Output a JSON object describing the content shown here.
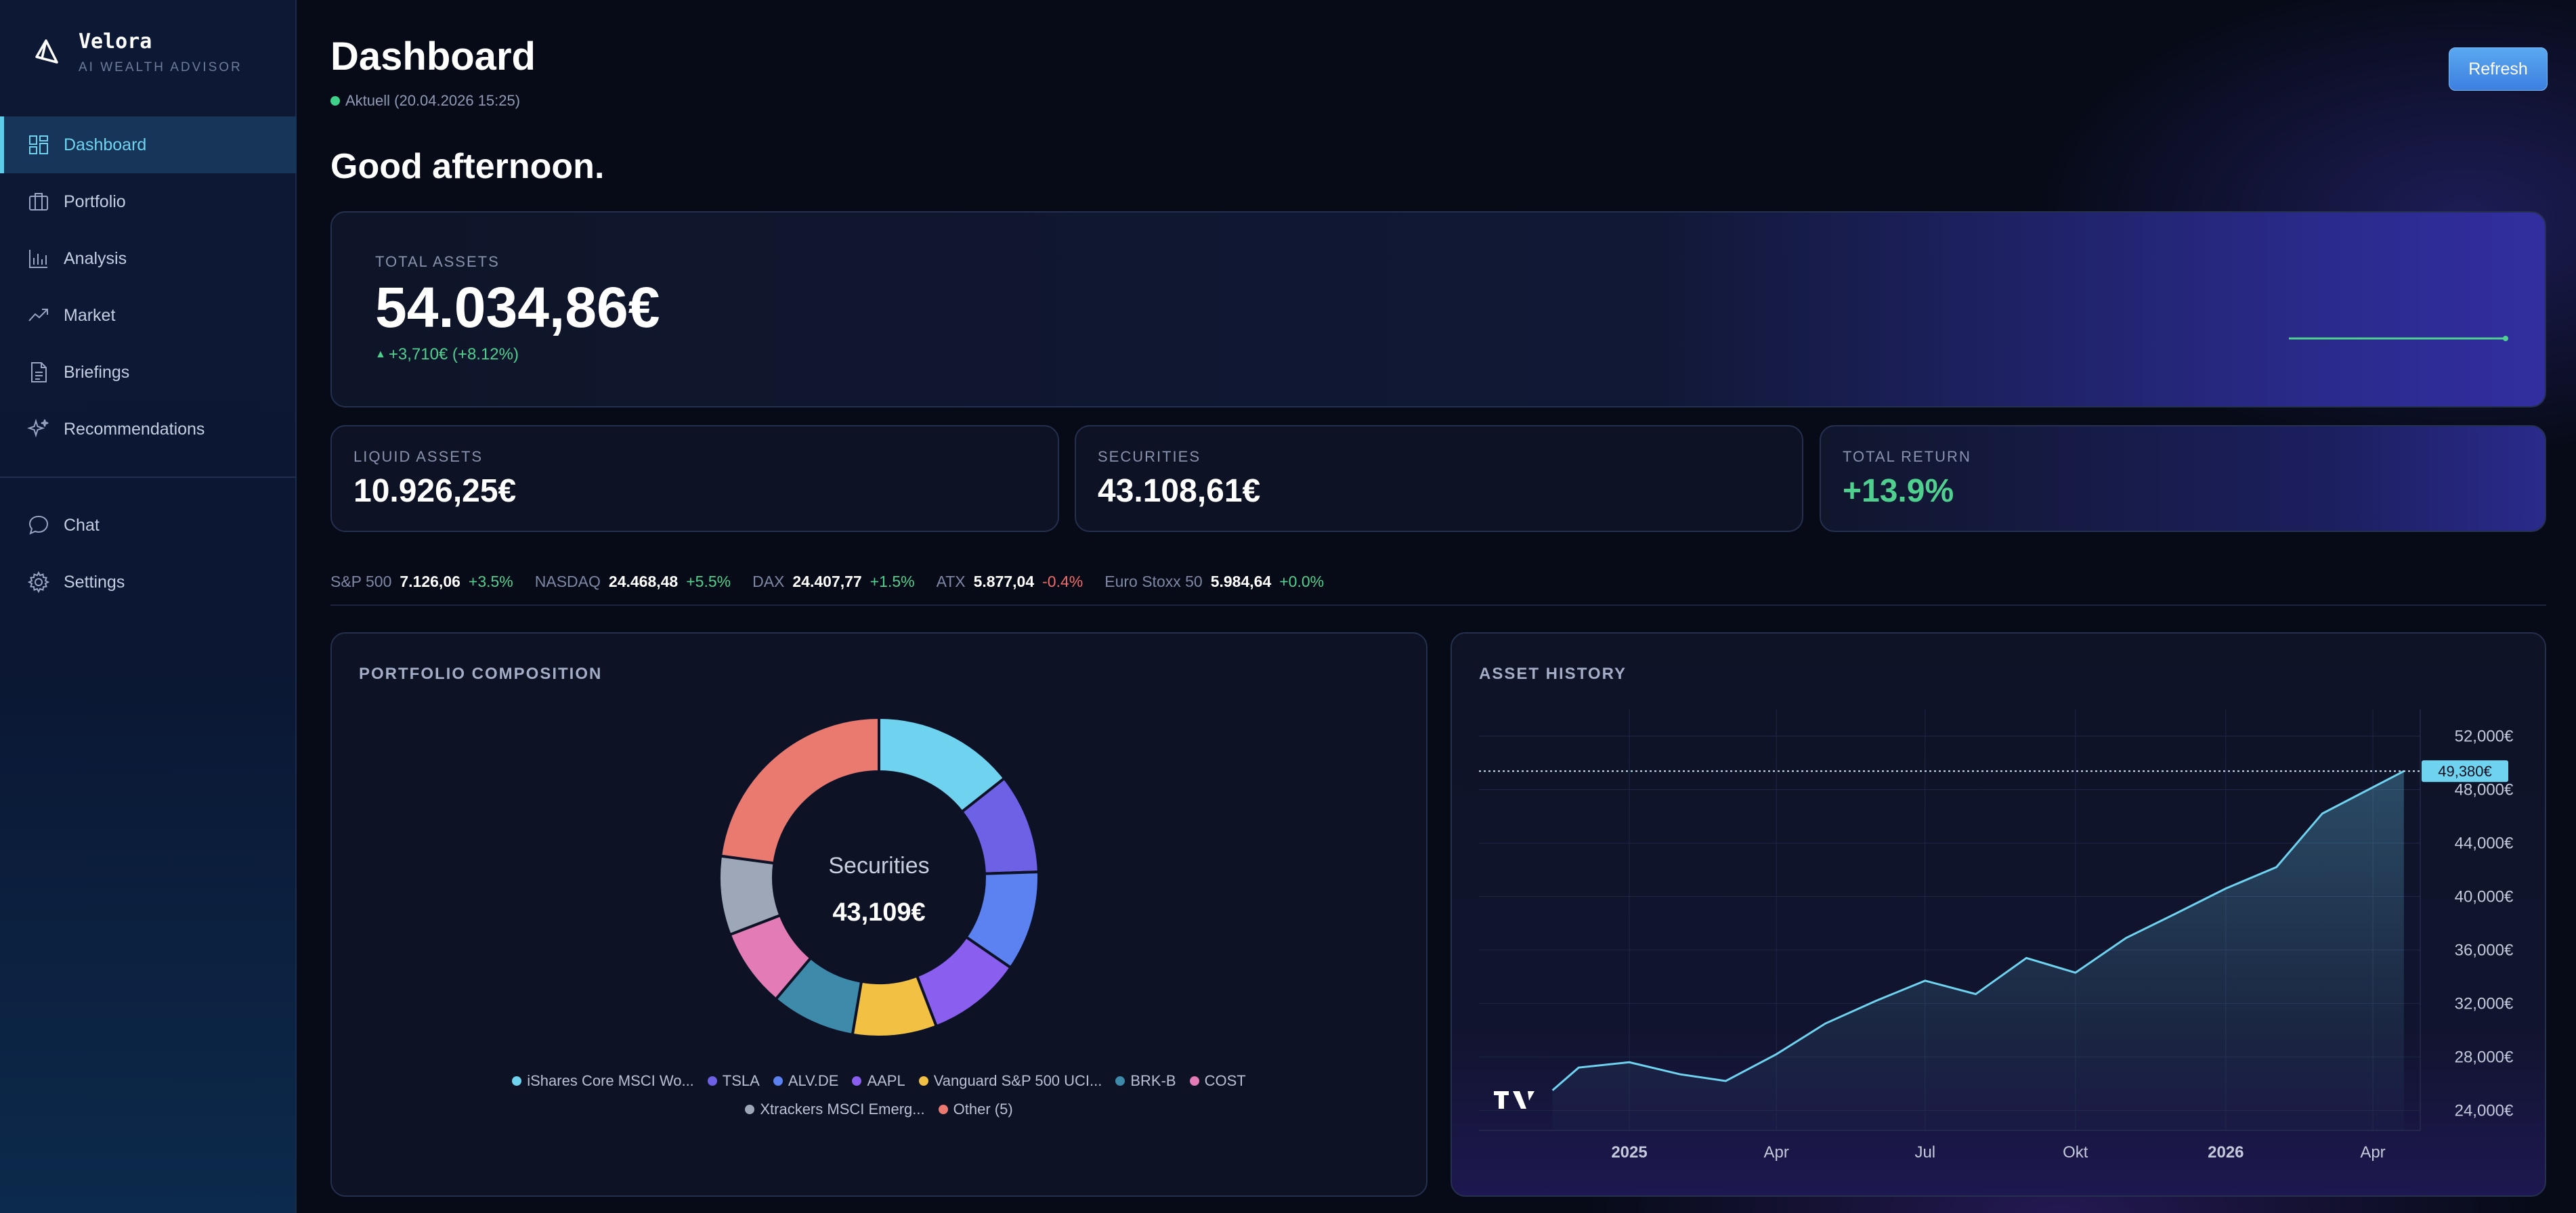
{
  "app": {
    "brand_name": "Velora",
    "brand_sub": "AI WEALTH ADVISOR"
  },
  "sidebar": {
    "items": [
      {
        "label": "Dashboard",
        "icon": "grid-icon",
        "active": true
      },
      {
        "label": "Portfolio",
        "icon": "briefcase-icon"
      },
      {
        "label": "Analysis",
        "icon": "bar-chart-icon"
      },
      {
        "label": "Market",
        "icon": "trend-icon"
      },
      {
        "label": "Briefings",
        "icon": "document-icon"
      },
      {
        "label": "Recommendations",
        "icon": "sparkle-icon"
      }
    ],
    "secondary": [
      {
        "label": "Chat",
        "icon": "chat-icon"
      },
      {
        "label": "Settings",
        "icon": "gear-icon"
      }
    ]
  },
  "header": {
    "title": "Dashboard",
    "status": "Aktuell (20.04.2026 15:25)",
    "refresh_label": "Refresh",
    "greeting": "Good afternoon."
  },
  "total": {
    "label": "TOTAL ASSETS",
    "value": "54.034,86€",
    "change": "+3,710€ (+8.12%)"
  },
  "stats": [
    {
      "label": "LIQUID ASSETS",
      "value": "10.926,25€"
    },
    {
      "label": "SECURITIES",
      "value": "43.108,61€"
    },
    {
      "label": "TOTAL RETURN",
      "value": "+13.9%"
    }
  ],
  "ticker": [
    {
      "name": "S&P 500",
      "price": "7.126,06",
      "change": "+3.5%",
      "dir": "up"
    },
    {
      "name": "NASDAQ",
      "price": "24.468,48",
      "change": "+5.5%",
      "dir": "up"
    },
    {
      "name": "DAX",
      "price": "24.407,77",
      "change": "+1.5%",
      "dir": "up"
    },
    {
      "name": "ATX",
      "price": "5.877,04",
      "change": "-0.4%",
      "dir": "down"
    },
    {
      "name": "Euro Stoxx 50",
      "price": "5.984,64",
      "change": "+0.0%",
      "dir": "flat"
    }
  ],
  "composition": {
    "title": "PORTFOLIO COMPOSITION",
    "center_label": "Securities",
    "center_value": "43,109€"
  },
  "history": {
    "title": "ASSET HISTORY",
    "current_label": "49,380€"
  },
  "colors": {
    "accent": "#5ecdea",
    "up": "#4fd08f",
    "down": "#f06a6a"
  },
  "chart_data": [
    {
      "type": "pie",
      "title": "PORTFOLIO COMPOSITION",
      "slices": [
        {
          "label": "iShares Core MSCI Wo...",
          "value": 13.5,
          "color": "#6fd3ef"
        },
        {
          "label": "TSLA",
          "value": 9.5,
          "color": "#6d62e6"
        },
        {
          "label": "ALV.DE",
          "value": 9.5,
          "color": "#5b82f0"
        },
        {
          "label": "AAPL",
          "value": 9,
          "color": "#8a5ff0"
        },
        {
          "label": "Vanguard S&P 500 UCI...",
          "value": 8,
          "color": "#f2c144"
        },
        {
          "label": "BRK-B",
          "value": 8,
          "color": "#3e8aab"
        },
        {
          "label": "COST",
          "value": 7.5,
          "color": "#e27bb6"
        },
        {
          "label": "Xtrackers MSCI Emerg...",
          "value": 7.5,
          "color": "#9ea7b8"
        },
        {
          "label": "Other (5)",
          "value": 21.5,
          "color": "#ea7a70"
        }
      ]
    },
    {
      "type": "area",
      "title": "ASSET HISTORY",
      "x_ticks": [
        "2025",
        "Apr",
        "Jul",
        "Okt",
        "2026",
        "Apr"
      ],
      "y_ticks": [
        "52,000€",
        "48,000€",
        "44,000€",
        "40,000€",
        "36,000€",
        "32,000€",
        "28,000€",
        "24,000€"
      ],
      "ylim": [
        22500,
        54000
      ],
      "x": [
        "2024-11-15",
        "2024-12-01",
        "2025-01-01",
        "2025-02-01",
        "2025-03-01",
        "2025-04-01",
        "2025-05-01",
        "2025-06-01",
        "2025-07-01",
        "2025-08-01",
        "2025-09-01",
        "2025-10-01",
        "2025-11-01",
        "2025-12-01",
        "2026-01-01",
        "2026-02-01",
        "2026-03-01",
        "2026-04-20"
      ],
      "values": [
        25500,
        27200,
        27600,
        26700,
        26200,
        28200,
        30500,
        32200,
        33700,
        32700,
        35400,
        34300,
        36900,
        38700,
        40600,
        42200,
        46200,
        49380
      ]
    }
  ]
}
